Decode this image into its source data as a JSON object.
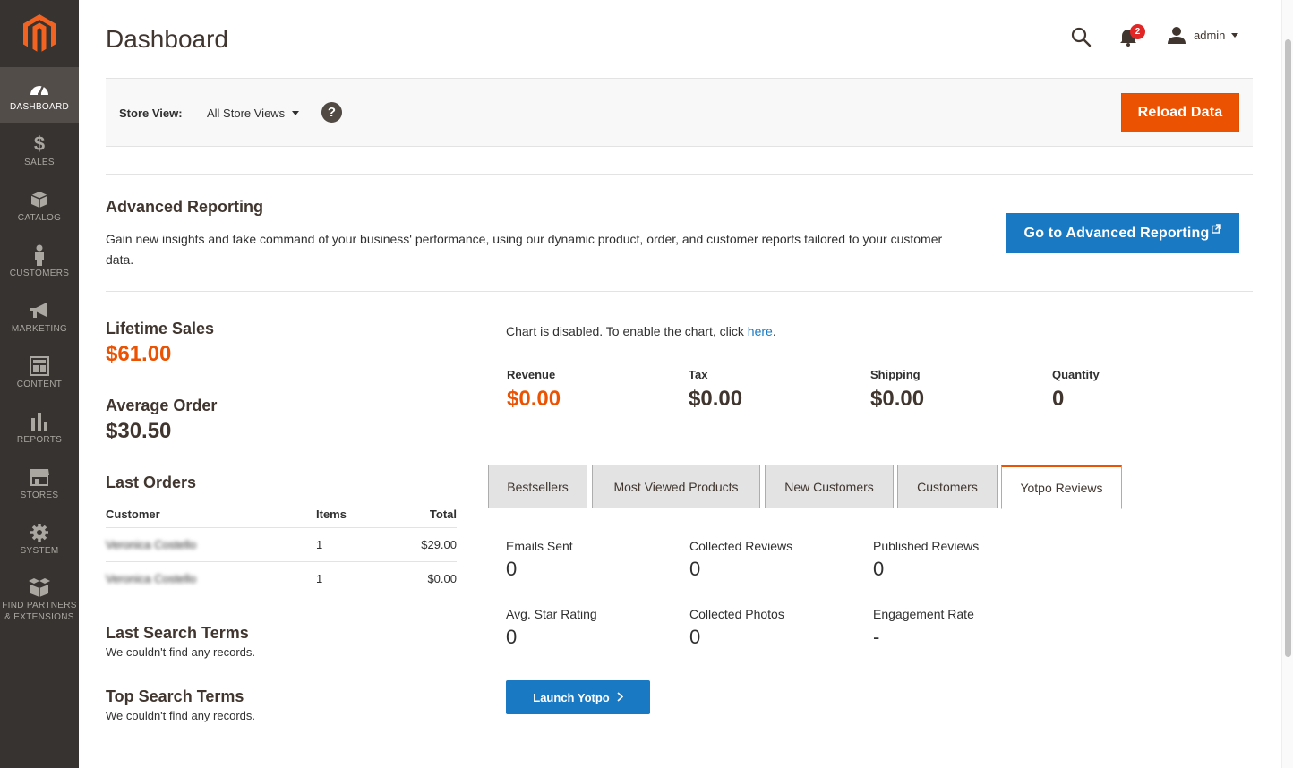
{
  "sidebar": {
    "items": [
      {
        "label": "Dashboard",
        "icon": "dashboard-icon",
        "active": true
      },
      {
        "label": "Sales",
        "icon": "dollar-icon"
      },
      {
        "label": "Catalog",
        "icon": "box-icon"
      },
      {
        "label": "Customers",
        "icon": "person-icon"
      },
      {
        "label": "Marketing",
        "icon": "megaphone-icon"
      },
      {
        "label": "Content",
        "icon": "layout-icon"
      },
      {
        "label": "Reports",
        "icon": "bar-chart-icon"
      },
      {
        "label": "Stores",
        "icon": "store-icon"
      },
      {
        "label": "System",
        "icon": "gear-icon"
      },
      {
        "label": "Find Partners & Extensions",
        "icon": "extensions-icon"
      }
    ]
  },
  "header": {
    "title": "Dashboard",
    "notification_count": "2",
    "user_name": "admin"
  },
  "store_bar": {
    "label": "Store View:",
    "selected": "All Store Views",
    "help": "?",
    "reload_label": "Reload Data"
  },
  "advanced_reporting": {
    "title": "Advanced Reporting",
    "description": "Gain new insights and take command of your business' performance, using our dynamic product, order, and customer reports tailored to your customer data.",
    "button_label": "Go to Advanced Reporting"
  },
  "stats": {
    "lifetime_sales_label": "Lifetime Sales",
    "lifetime_sales_value": "$61.00",
    "average_order_label": "Average Order",
    "average_order_value": "$30.50"
  },
  "last_orders": {
    "title": "Last Orders",
    "columns": [
      "Customer",
      "Items",
      "Total"
    ],
    "rows": [
      {
        "customer": "Veronica Costello",
        "items": "1",
        "total": "$29.00"
      },
      {
        "customer": "Veronica Costello",
        "items": "1",
        "total": "$0.00"
      }
    ]
  },
  "last_search": {
    "title": "Last Search Terms",
    "empty": "We couldn't find any records."
  },
  "top_search": {
    "title": "Top Search Terms",
    "empty": "We couldn't find any records."
  },
  "chart": {
    "note_prefix": "Chart is disabled. To enable the chart, click ",
    "note_link": "here",
    "note_suffix": "."
  },
  "totals": [
    {
      "label": "Revenue",
      "value": "$0.00"
    },
    {
      "label": "Tax",
      "value": "$0.00"
    },
    {
      "label": "Shipping",
      "value": "$0.00"
    },
    {
      "label": "Quantity",
      "value": "0"
    }
  ],
  "tabs": [
    {
      "label": "Bestsellers"
    },
    {
      "label": "Most Viewed Products"
    },
    {
      "label": "New Customers"
    },
    {
      "label": "Customers"
    },
    {
      "label": "Yotpo Reviews",
      "active": true
    }
  ],
  "yotpo": {
    "metrics": [
      {
        "label": "Emails Sent",
        "value": "0"
      },
      {
        "label": "Collected Reviews",
        "value": "0"
      },
      {
        "label": "Published Reviews",
        "value": "0"
      },
      {
        "label": "Avg. Star Rating",
        "value": "0"
      },
      {
        "label": "Collected Photos",
        "value": "0"
      },
      {
        "label": "Engagement Rate",
        "value": "-"
      }
    ],
    "launch_label": "Launch Yotpo"
  },
  "colors": {
    "sidebar_bg": "#373330",
    "accent_orange": "#eb5202",
    "primary_blue": "#1979c3"
  }
}
